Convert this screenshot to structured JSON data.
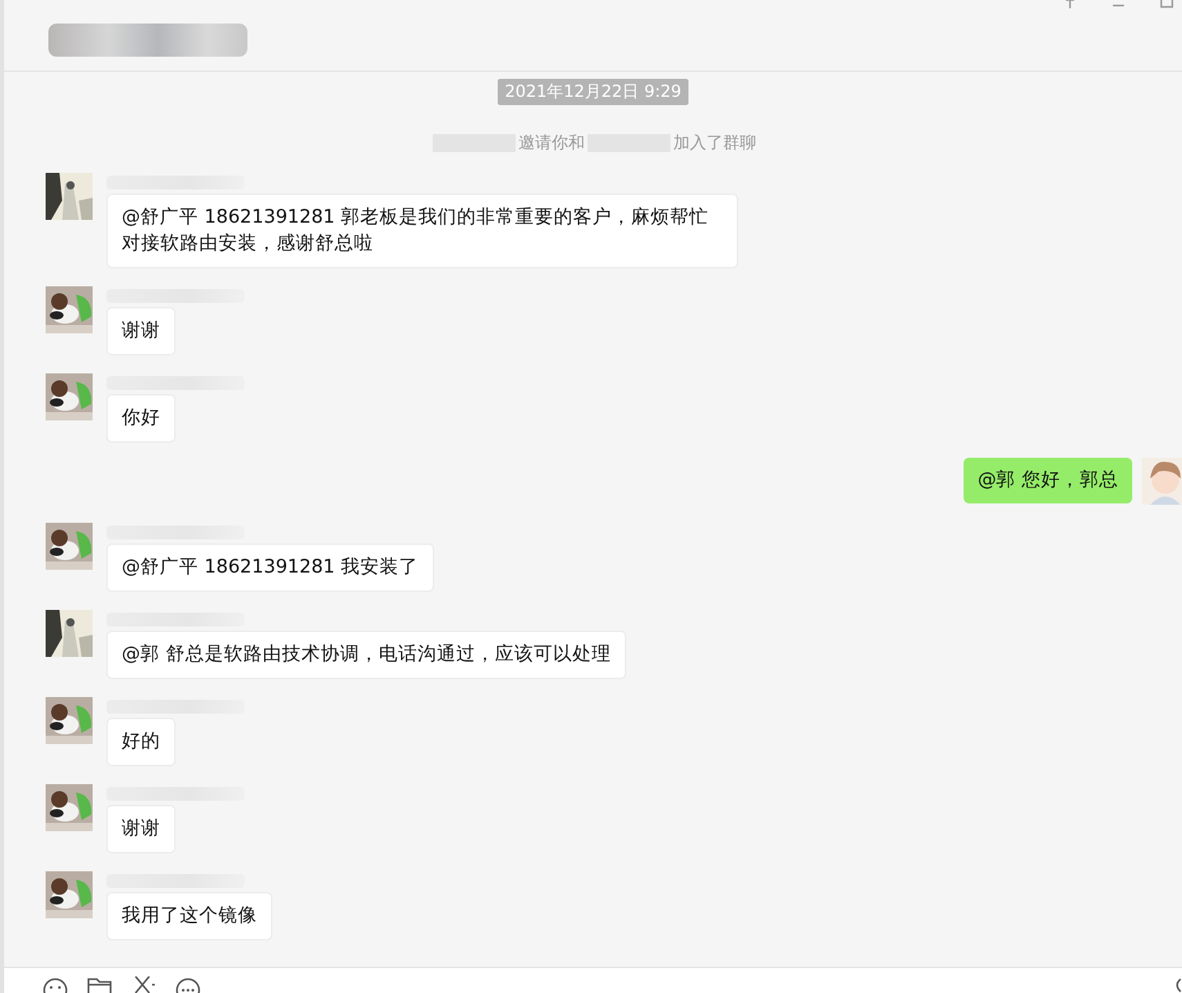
{
  "header": {
    "title_hidden": true
  },
  "timestamp": "2021年12月22日 9:29",
  "system_message": {
    "parts": [
      {
        "kind": "hidden"
      },
      {
        "kind": "text",
        "text": "邀请你和"
      },
      {
        "kind": "hidden"
      },
      {
        "kind": "text",
        "text": "加入了群聊"
      }
    ]
  },
  "messages": [
    {
      "kind": "received",
      "text": "@舒广平  18621391281 郭老板是我们的非常重要的客户，麻烦帮忙对接软路由安装，感谢舒总啦"
    },
    {
      "kind": "received",
      "text": "谢谢"
    },
    {
      "kind": "received",
      "text": "你好"
    },
    {
      "kind": "sent",
      "text": "@郭 您好，郭总"
    },
    {
      "kind": "received",
      "text": "@舒广平  18621391281 我安装了"
    },
    {
      "kind": "received",
      "text": "@郭 舒总是软路由技术协调，电话沟通过，应该可以处理"
    },
    {
      "kind": "received",
      "text": "好的"
    },
    {
      "kind": "received",
      "text": "谢谢"
    },
    {
      "kind": "received",
      "text": "我用了这个镜像"
    }
  ]
}
